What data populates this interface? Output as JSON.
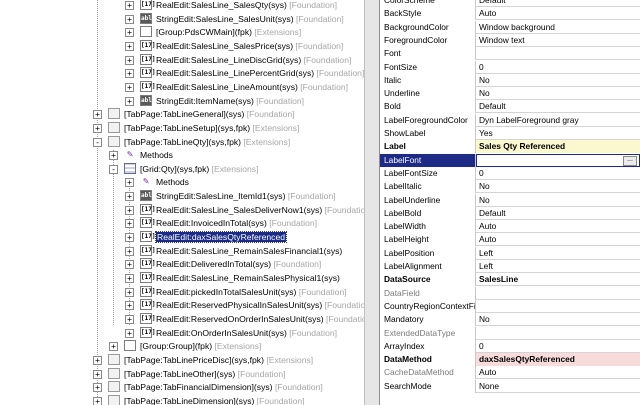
{
  "tree": [
    {
      "depth": 5,
      "expander": "+",
      "icon": "real",
      "text": "RealEdit:SalesLine_SalesQty(sys)",
      "layer": "[Foundation]"
    },
    {
      "depth": 5,
      "expander": "+",
      "icon": "str",
      "text": "StringEdit:SalesLine_SalesUnit(sys)",
      "layer": "[Foundation]"
    },
    {
      "depth": 5,
      "expander": "+",
      "icon": "grp",
      "text": "[Group:PdsCWMain](fpk)",
      "layer": "[Extensions]"
    },
    {
      "depth": 5,
      "expander": "+",
      "icon": "real",
      "text": "RealEdit:SalesLine_SalesPrice(sys)",
      "layer": "[Foundation]"
    },
    {
      "depth": 5,
      "expander": "+",
      "icon": "real",
      "text": "RealEdit:SalesLine_LineDiscGrid(sys)",
      "layer": "[Foundation]"
    },
    {
      "depth": 5,
      "expander": "+",
      "icon": "real",
      "text": "RealEdit:SalesLine_LinePercentGrid(sys)",
      "layer": "[Foundation]"
    },
    {
      "depth": 5,
      "expander": "+",
      "icon": "real",
      "text": "RealEdit:SalesLine_LineAmount(sys)",
      "layer": "[Foundation]"
    },
    {
      "depth": 5,
      "expander": "+",
      "icon": "str",
      "text": "StringEdit:ItemName(sys)",
      "layer": "[Foundation]"
    },
    {
      "depth": 3,
      "expander": "+",
      "icon": "tab",
      "text": "[TabPage:TabLineGeneral](sys)",
      "layer": "[Foundation]"
    },
    {
      "depth": 3,
      "expander": "+",
      "icon": "tab",
      "text": "[TabPage:TabLineSetup](sys,fpk)",
      "layer": "[Extensions]"
    },
    {
      "depth": 3,
      "expander": "-",
      "icon": "tab",
      "text": "[TabPage:TabLineQty](sys,fpk)",
      "layer": "[Extensions]"
    },
    {
      "depth": 4,
      "expander": "+",
      "icon": "meth",
      "text": "Methods",
      "layer": ""
    },
    {
      "depth": 4,
      "expander": "-",
      "icon": "grid",
      "text": "[Grid:Qty](sys,fpk)",
      "layer": "[Extensions]"
    },
    {
      "depth": 5,
      "expander": "+",
      "icon": "meth",
      "text": "Methods",
      "layer": ""
    },
    {
      "depth": 5,
      "expander": "+",
      "icon": "str",
      "text": "StringEdit:SalesLine_ItemId1(sys)",
      "layer": "[Foundation]"
    },
    {
      "depth": 5,
      "expander": "+",
      "icon": "real",
      "text": "RealEdit:SalesLine_SalesDeliverNow1(sys)",
      "layer": "[Foundation]"
    },
    {
      "depth": 5,
      "expander": "+",
      "icon": "real",
      "text": "RealEdit:InvoicedInTotal(sys)",
      "layer": "[Foundation]"
    },
    {
      "depth": 5,
      "expander": "+",
      "icon": "real",
      "text": "RealEdit:daxSalesQtyReferenced",
      "layer": "",
      "selected": true
    },
    {
      "depth": 5,
      "expander": "+",
      "icon": "real",
      "text": "RealEdit:SalesLine_RemainSalesFinancial1(sys)",
      "layer": ""
    },
    {
      "depth": 5,
      "expander": "+",
      "icon": "real",
      "text": "RealEdit:DeliveredInTotal(sys)",
      "layer": "[Foundation]"
    },
    {
      "depth": 5,
      "expander": "+",
      "icon": "real",
      "text": "RealEdit:SalesLine_RemainSalesPhysical1(sys)",
      "layer": ""
    },
    {
      "depth": 5,
      "expander": "+",
      "icon": "real",
      "text": "RealEdit:pickedInTotalSalesUnit(sys)",
      "layer": "[Foundation]"
    },
    {
      "depth": 5,
      "expander": "+",
      "icon": "real",
      "text": "RealEdit:ReservedPhysicalInSalesUnit(sys)",
      "layer": "[Foundation]"
    },
    {
      "depth": 5,
      "expander": "+",
      "icon": "real",
      "text": "RealEdit:ReservedOnOrderInSalesUnit(sys)",
      "layer": "[Foundation]"
    },
    {
      "depth": 5,
      "expander": "+",
      "icon": "real",
      "text": "RealEdit:OnOrderInSalesUnit(sys)",
      "layer": "[Foundation]"
    },
    {
      "depth": 4,
      "expander": "+",
      "icon": "grp",
      "text": "[Group:Group](fpk)",
      "layer": "[Extensions]"
    },
    {
      "depth": 3,
      "expander": "+",
      "icon": "tab",
      "text": "[TabPage:TabLinePriceDisc](sys,fpk)",
      "layer": "[Extensions]"
    },
    {
      "depth": 3,
      "expander": "+",
      "icon": "tab",
      "text": "[TabPage:TabLineOther](sys)",
      "layer": "[Foundation]"
    },
    {
      "depth": 3,
      "expander": "+",
      "icon": "tab",
      "text": "[TabPage:TabFinancialDimension](sys)",
      "layer": "[Foundation]"
    },
    {
      "depth": 3,
      "expander": "+",
      "icon": "tab",
      "text": "[TabPage:TabLineDimension](sys)",
      "layer": "[Foundation]"
    }
  ],
  "icon_glyphs": {
    "real": "[17]",
    "str": "abl",
    "grp": "",
    "tab": "",
    "grid": "",
    "meth": "✎"
  },
  "properties": [
    {
      "name": "ColorScheme",
      "value": "Default"
    },
    {
      "name": "BackStyle",
      "value": "Auto"
    },
    {
      "name": "BackgroundColor",
      "value": "Window background"
    },
    {
      "name": "ForegroundColor",
      "value": "Window text"
    },
    {
      "name": "Font",
      "value": ""
    },
    {
      "name": "FontSize",
      "value": "0"
    },
    {
      "name": "Italic",
      "value": "No"
    },
    {
      "name": "Underline",
      "value": "No"
    },
    {
      "name": "Bold",
      "value": "Default"
    },
    {
      "name": "LabelForegroundColor",
      "value": "Dyn LabelForeground gray"
    },
    {
      "name": "ShowLabel",
      "value": "Yes"
    },
    {
      "name": "Label",
      "value": "Sales Qty Referenced",
      "style": "bold-yellow"
    },
    {
      "name": "LabelFont",
      "value": "",
      "style": "selected",
      "lookup": "..."
    },
    {
      "name": "LabelFontSize",
      "value": "0"
    },
    {
      "name": "LabelItalic",
      "value": "No"
    },
    {
      "name": "LabelUnderline",
      "value": "No"
    },
    {
      "name": "LabelBold",
      "value": "Default"
    },
    {
      "name": "LabelWidth",
      "value": "Auto"
    },
    {
      "name": "LabelHeight",
      "value": "Auto"
    },
    {
      "name": "LabelPosition",
      "value": "Left"
    },
    {
      "name": "LabelAlignment",
      "value": "Left"
    },
    {
      "name": "DataSource",
      "value": "SalesLine",
      "style": "bold"
    },
    {
      "name": "DataField",
      "value": "",
      "style": "disabled"
    },
    {
      "name": "CountryRegionContextField",
      "value": ""
    },
    {
      "name": "Mandatory",
      "value": "No"
    },
    {
      "name": "ExtendedDataType",
      "value": "",
      "style": "disabled"
    },
    {
      "name": "ArrayIndex",
      "value": "0"
    },
    {
      "name": "DataMethod",
      "value": "daxSalesQtyReferenced",
      "style": "bold-pink"
    },
    {
      "name": "CacheDataMethod",
      "value": "Auto",
      "style": "disabled"
    },
    {
      "name": "SearchMode",
      "value": "None"
    }
  ]
}
